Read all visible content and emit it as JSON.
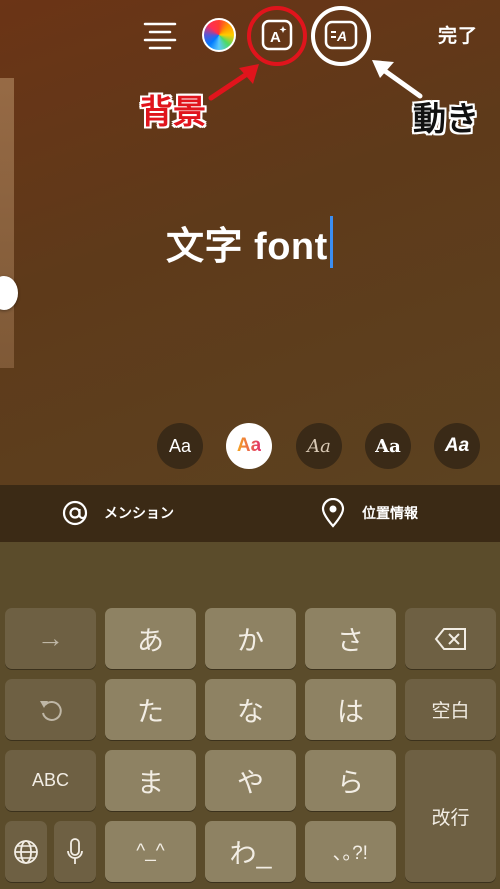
{
  "toolbar": {
    "done_label": "完了",
    "icons": [
      "align-lines-icon",
      "color-wheel-icon",
      "text-background-icon",
      "text-animation-icon"
    ],
    "bg_tool_glyph": "A",
    "anim_tool_glyph": "A"
  },
  "annotations": {
    "background_label": "背景",
    "animation_label": "動き",
    "highlight_color": "#e0141c"
  },
  "editor": {
    "text": "文字 font",
    "caret_color": "#3b8ef2"
  },
  "font_styles": [
    {
      "label": "Aa"
    },
    {
      "label": "Aa"
    },
    {
      "label": "Aa"
    },
    {
      "label": "Aa"
    },
    {
      "label": "Aa"
    }
  ],
  "mention_bar": {
    "mention_label": "メンション",
    "location_label": "位置情報"
  },
  "keyboard": {
    "rows": [
      [
        "→",
        "あ",
        "か",
        "さ"
      ],
      [
        "た",
        "な",
        "は",
        "空白"
      ],
      [
        "ABC",
        "ま",
        "や",
        "ら",
        "改行"
      ],
      [
        "^_^",
        "わ_",
        "､｡?!"
      ]
    ],
    "labels": {
      "arrow": "→",
      "a": "あ",
      "ka": "か",
      "sa": "さ",
      "ta": "た",
      "na": "な",
      "ha": "は",
      "space": "空白",
      "abc": "ABC",
      "ma": "ま",
      "ya": "や",
      "ra": "ら",
      "enter": "改行",
      "emoticon": "^_^",
      "wa": "わ_",
      "punct": "､｡?!"
    }
  }
}
